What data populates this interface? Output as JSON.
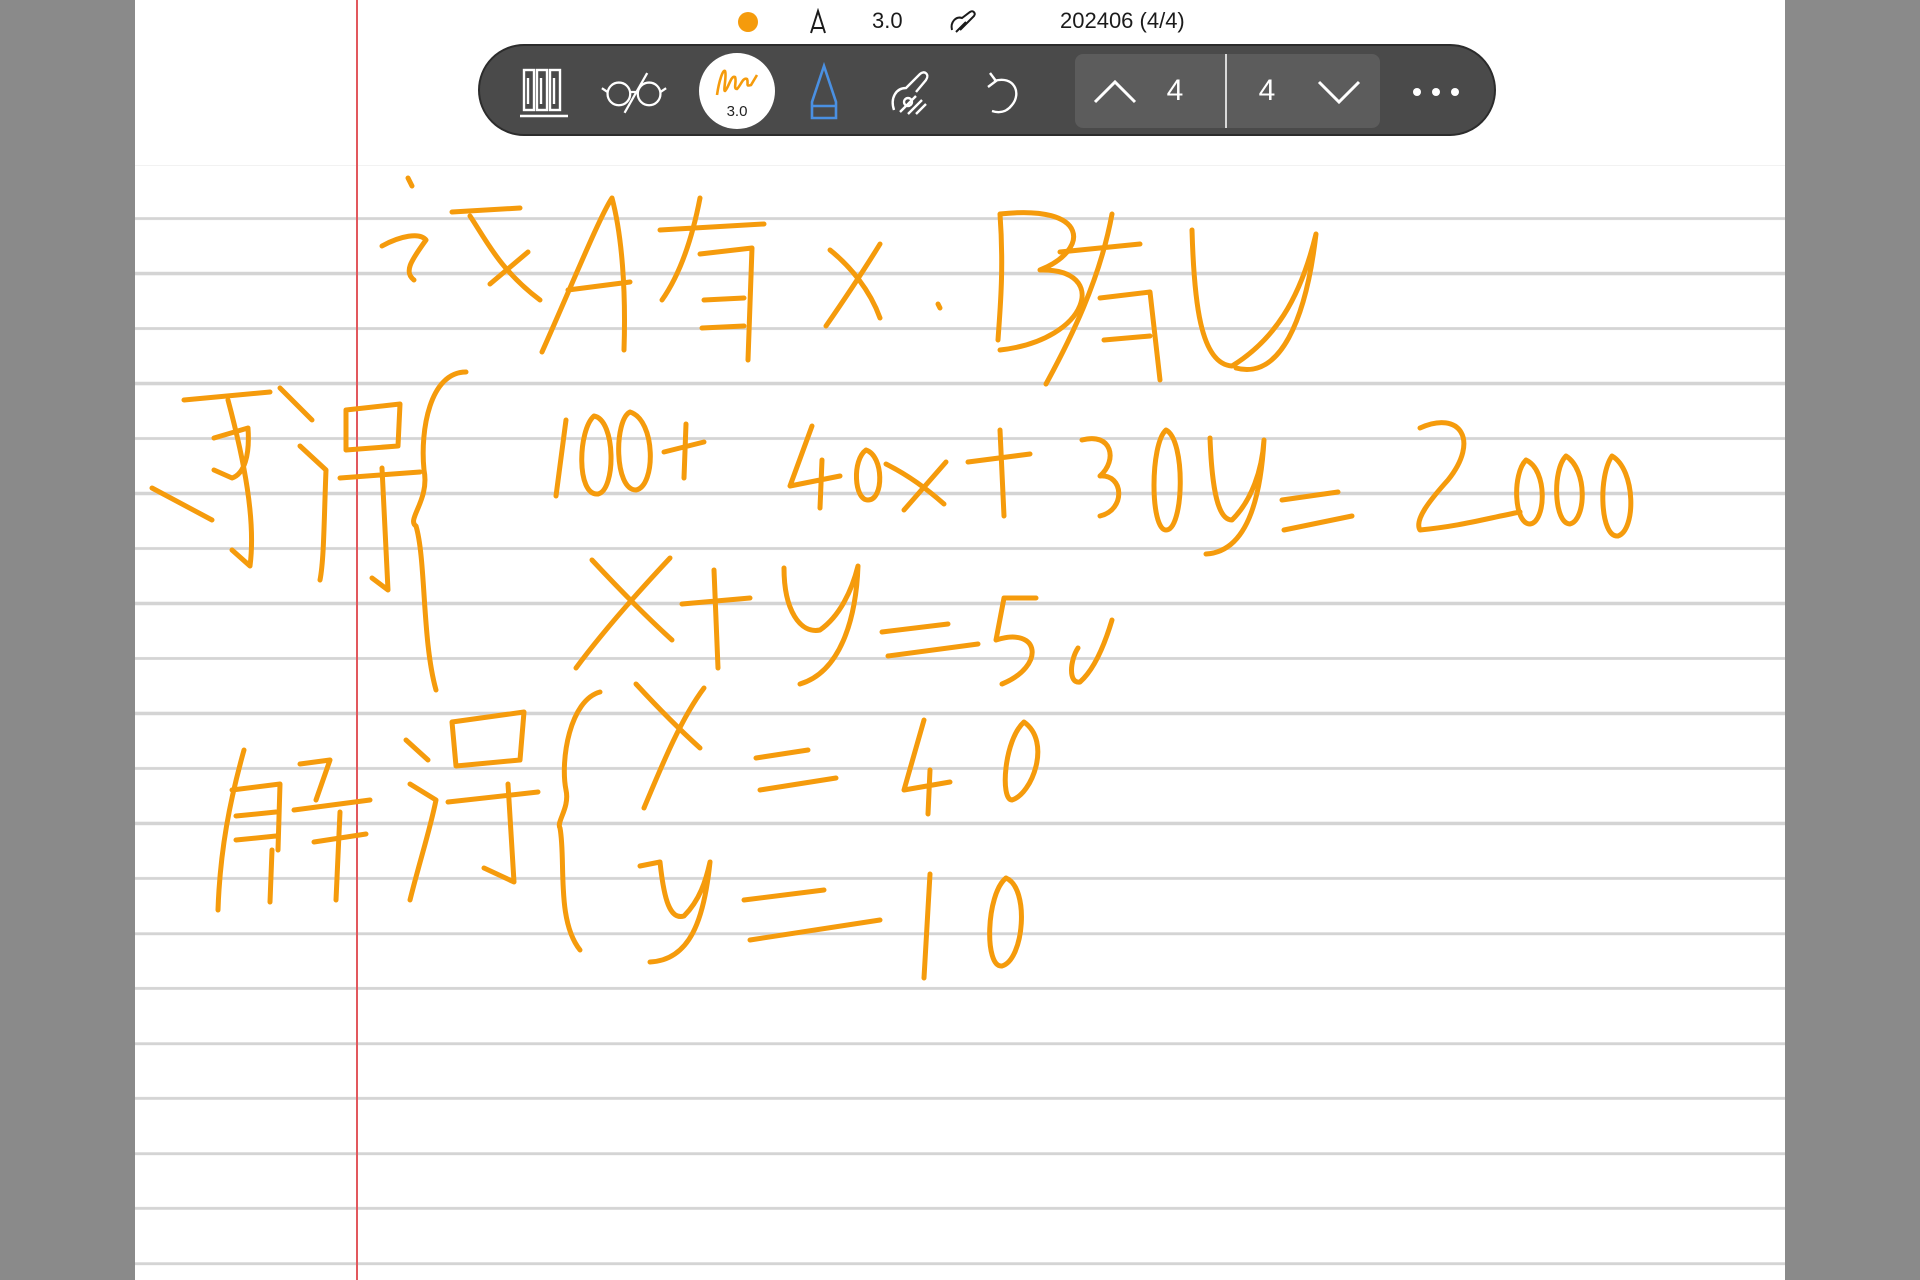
{
  "status": {
    "color_dot": "#f59b0c",
    "pen_width": "3.0",
    "document_title": "202406 (4/4)"
  },
  "toolbar": {
    "active_pen_width": "3.0",
    "prev_page_value": "4",
    "next_page_value": "4",
    "icons": [
      "library-icon",
      "reading-glasses-icon",
      "pen-icon",
      "pencil-icon",
      "touch-gesture-icon",
      "undo-icon",
      "chevron-up-icon",
      "chevron-down-icon",
      "more-icon"
    ]
  },
  "colors": {
    "ink": "#f59b0c",
    "toolbar_bg": "#4a4a4a",
    "paper_rule": "#d4d4d4",
    "margin_rule": "#e2585d"
  },
  "note": {
    "lines": [
      "设A有x B有y",
      "可得 { 100+40x+30y=2000",
      "x+y=50",
      "解得 { x=40",
      "y=10"
    ]
  }
}
